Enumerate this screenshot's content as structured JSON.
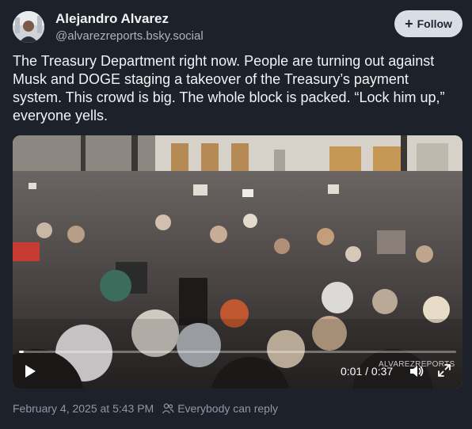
{
  "author": {
    "display_name": "Alejandro Alvarez",
    "handle": "@alvarezreports.bsky.social",
    "avatar_icon": "avatar-image"
  },
  "follow_button": {
    "label": "Follow",
    "icon": "plus-icon"
  },
  "post": {
    "text": "The Treasury Department right now. People are turning out against Musk and DOGE staging a takeover of the Treasury’s payment system. This crowd is big. The whole block is packed. “Lock him up,” everyone yells."
  },
  "video": {
    "current_time": "0:01",
    "duration": "0:37",
    "time_separator": " / ",
    "progress": 0.01,
    "watermark": "ALVAREZREPORTS",
    "controls": [
      "play-icon",
      "volume-icon",
      "fullscreen-icon"
    ]
  },
  "footer": {
    "timestamp": "February 4, 2025 at 5:43 PM",
    "reply_setting": "Everybody can reply",
    "reply_icon": "people-icon"
  }
}
